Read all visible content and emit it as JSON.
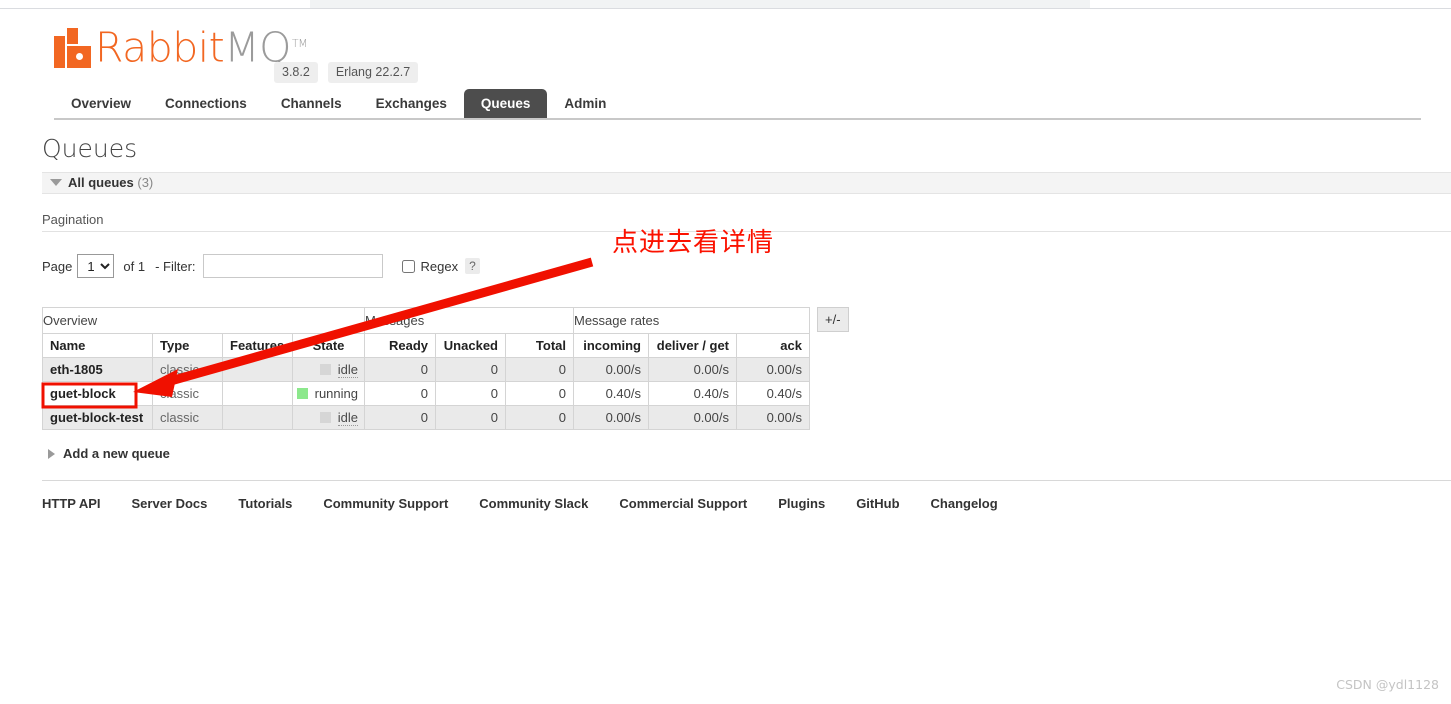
{
  "browser": {
    "tab_present": true
  },
  "brand": {
    "name_part1": "Rabbit",
    "name_part2": "MQ",
    "trademark": "TM",
    "version": "3.8.2",
    "erlang": "Erlang 22.2.7",
    "logo_icon": "rabbitmq-logo-icon"
  },
  "nav": {
    "items": [
      {
        "label": "Overview",
        "active": false
      },
      {
        "label": "Connections",
        "active": false
      },
      {
        "label": "Channels",
        "active": false
      },
      {
        "label": "Exchanges",
        "active": false
      },
      {
        "label": "Queues",
        "active": true
      },
      {
        "label": "Admin",
        "active": false
      }
    ]
  },
  "main": {
    "page_title": "Queues",
    "section": {
      "label": "All queues",
      "count": "(3)",
      "toggle_icon": "triangle-down-icon"
    },
    "pagination": {
      "title": "Pagination",
      "page_label": "Page",
      "page_value": "1",
      "page_options": [
        "1"
      ],
      "of_label": "of 1",
      "filter_label": "- Filter:",
      "filter_value": "",
      "filter_placeholder": "",
      "regex_label": "Regex",
      "regex_checked": false,
      "help_label": "?"
    },
    "table": {
      "group_headers": [
        {
          "label": "Overview",
          "span": 4
        },
        {
          "label": "Messages",
          "span": 3
        },
        {
          "label": "Message rates",
          "span": 3
        }
      ],
      "columns": [
        {
          "label": "Name",
          "align": "l"
        },
        {
          "label": "Type",
          "align": "l"
        },
        {
          "label": "Features",
          "align": "l"
        },
        {
          "label": "State",
          "align": "c"
        },
        {
          "label": "Ready",
          "align": "r"
        },
        {
          "label": "Unacked",
          "align": "r"
        },
        {
          "label": "Total",
          "align": "r"
        },
        {
          "label": "incoming",
          "align": "r"
        },
        {
          "label": "deliver / get",
          "align": "r"
        },
        {
          "label": "ack",
          "align": "r"
        }
      ],
      "rows": [
        {
          "name": "eth-1805",
          "type": "classic",
          "features": "",
          "state": "idle",
          "state_color": "idle",
          "ready": "0",
          "unacked": "0",
          "total": "0",
          "incoming": "0.00/s",
          "deliver_get": "0.00/s",
          "ack": "0.00/s"
        },
        {
          "name": "guet-block",
          "type": "classic",
          "features": "",
          "state": "running",
          "state_color": "running",
          "ready": "0",
          "unacked": "0",
          "total": "0",
          "incoming": "0.40/s",
          "deliver_get": "0.40/s",
          "ack": "0.40/s"
        },
        {
          "name": "guet-block-test",
          "type": "classic",
          "features": "",
          "state": "idle",
          "state_color": "idle",
          "ready": "0",
          "unacked": "0",
          "total": "0",
          "incoming": "0.00/s",
          "deliver_get": "0.00/s",
          "ack": "0.00/s"
        }
      ],
      "columns_toggle_label": "+/-"
    },
    "add_queue": {
      "label": "Add a new queue",
      "toggle_icon": "triangle-right-icon"
    }
  },
  "footer": {
    "links": [
      "HTTP API",
      "Server Docs",
      "Tutorials",
      "Community Support",
      "Community Slack",
      "Commercial Support",
      "Plugins",
      "GitHub",
      "Changelog"
    ]
  },
  "annotations": {
    "callout_text": "点进去看详情",
    "callout_color": "#fb1200",
    "arrow": "red-arrow-pointing-to-guet-block",
    "highlight_box": "red-box-around-guet-block-name"
  },
  "watermark": {
    "text": "CSDN @ydl1128"
  }
}
